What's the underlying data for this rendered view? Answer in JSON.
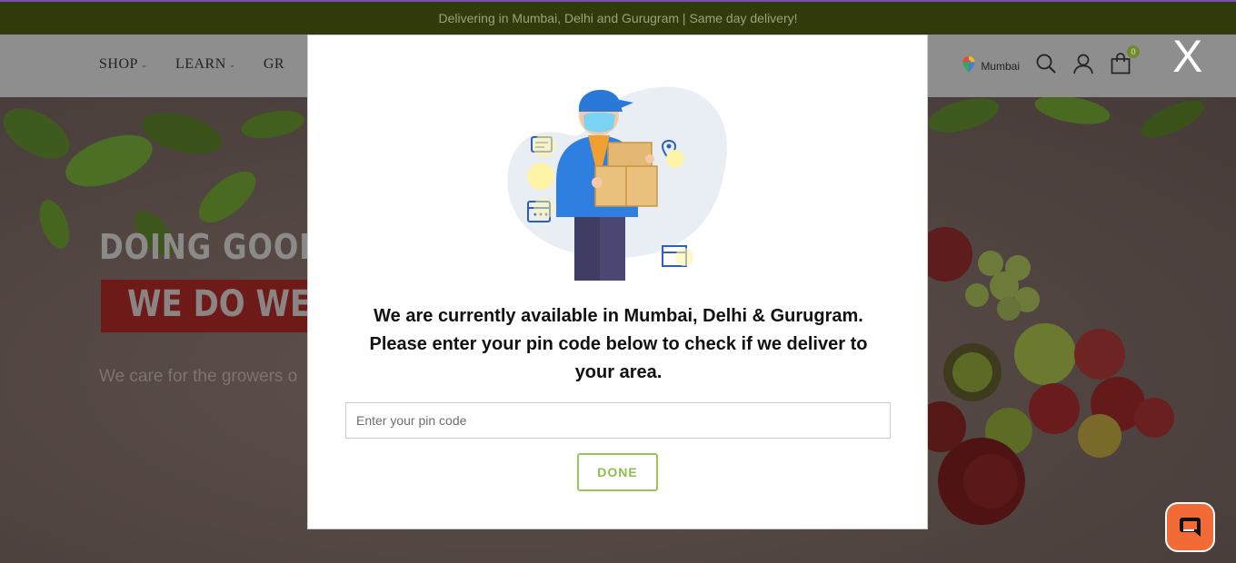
{
  "topbar": {
    "text": "Delivering in Mumbai, Delhi and Gurugram | Same day delivery!"
  },
  "header": {
    "nav": [
      {
        "label": "SHOP",
        "icon": "chevron-down-icon"
      },
      {
        "label": "LEARN",
        "icon": "chevron-down-icon"
      },
      {
        "label": "GR"
      }
    ],
    "location": "Mumbai",
    "cart_count": "0"
  },
  "hero": {
    "line1": "DOING GOOD A",
    "line2": "WE DO WELL",
    "subtitle": "We care for the growers o"
  },
  "modal": {
    "close_label": "X",
    "message_line1": "We are currently available in Mumbai, Delhi & Gurugram.",
    "message_line2": "Please enter your pin code below to check if we deliver to",
    "message_line3": "your area.",
    "pin_placeholder": "Enter your pin code",
    "done_label": "DONE"
  },
  "colors": {
    "topbar_bg": "#2f3b0b",
    "accent_green": "#8dbf4a",
    "chat_orange": "#f26a35"
  }
}
